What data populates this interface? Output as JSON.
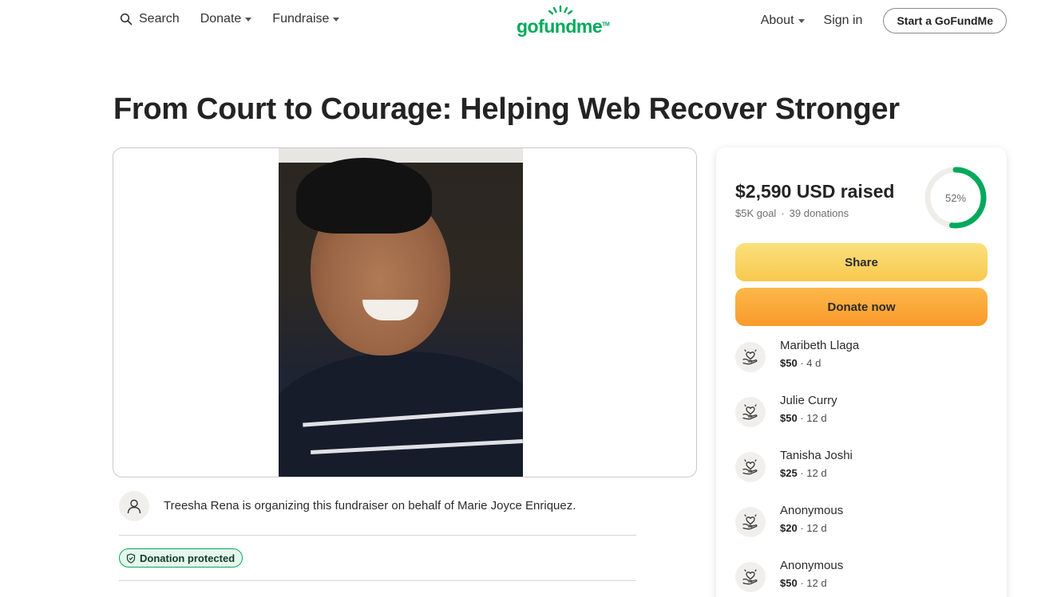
{
  "header": {
    "search_label": "Search",
    "donate_label": "Donate",
    "fundraise_label": "Fundraise",
    "logo_text": "gofundme",
    "about_label": "About",
    "signin_label": "Sign in",
    "start_label": "Start a GoFundMe"
  },
  "campaign": {
    "title": "From Court to Courage: Helping Web Recover Stronger",
    "organizer_text": "Treesha Rena is organizing this fundraiser on behalf of Marie Joyce Enriquez.",
    "protected_label": "Donation protected"
  },
  "panel": {
    "raised": "$2,590 USD raised",
    "goal": "$5K goal",
    "donations": "39 donations",
    "progress_label": "52%",
    "progress_fraction": 0.52,
    "share_label": "Share",
    "donate_label": "Donate now",
    "donors": [
      {
        "name": "Maribeth Llaga",
        "amount": "$50",
        "time": "4 d"
      },
      {
        "name": "Julie Curry",
        "amount": "$50",
        "time": "12 d"
      },
      {
        "name": "Tanisha Joshi",
        "amount": "$25",
        "time": "12 d"
      },
      {
        "name": "Anonymous",
        "amount": "$20",
        "time": "12 d"
      },
      {
        "name": "Anonymous",
        "amount": "$50",
        "time": "12 d"
      }
    ]
  },
  "colors": {
    "brand_green": "#02a95c",
    "share_yellow": "#f7c94e",
    "donate_orange": "#f99a2a"
  }
}
